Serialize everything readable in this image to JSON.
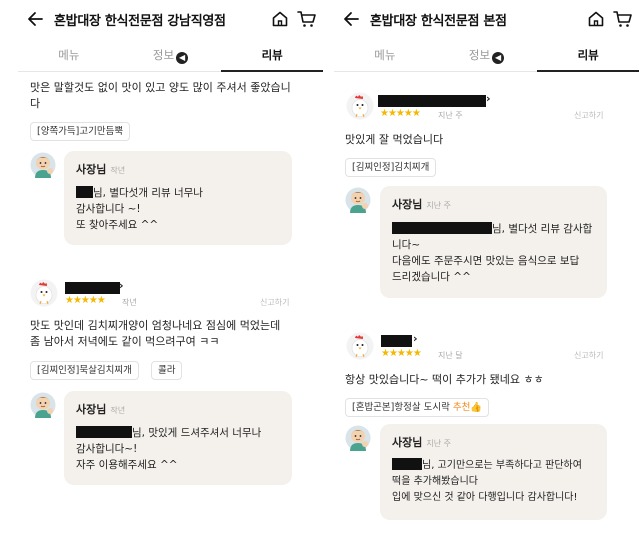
{
  "left": {
    "title": "혼밥대장 한식전문점 강남직영점",
    "tabs": [
      "메뉴",
      "정보",
      "리뷰"
    ],
    "review1_text": "맛은 말할것도 없이 맛이 있고 양도 많이 주셔서 좋았습니",
    "review1_text2": "다",
    "review1_tag": "[양쪽가득]고기만듬뿍",
    "reply1_name": "사장님",
    "reply1_name_small": "작년",
    "reply1_line1_suffix": "님, 별다섯개 리뷰 너무나",
    "reply1_line2": "감사합니다 ~!",
    "reply1_line3": "또 찾아주세요 ^^",
    "review2_stars": "★★★★★",
    "review2_date": "작년",
    "review2_report": "신고하기",
    "review2_text1": "맛도 맛인데 김치찌개양이 엄청나네요 점심에 먹었는데",
    "review2_text2": "좀 남아서 저녁에도 같이 먹으려구여 ㅋㅋ",
    "review2_tag1": "[김찌인정]묵살김치찌개",
    "review2_tag2": "콜라",
    "reply2_name": "사장님",
    "reply2_name_small": "작년",
    "reply2_line1_suffix": "님, 맛있게 드셔주셔서 너무나",
    "reply2_line2": "감사합니다~!",
    "reply2_line3": "자주 이용해주세요 ^^"
  },
  "right": {
    "title": "혼밥대장 한식전문점 본점",
    "tabs": [
      "메뉴",
      "정보",
      "리뷰"
    ],
    "review1_stars": "★★★★★",
    "review1_date": "지난 주",
    "review1_report": "신고하기",
    "review1_text": "맛있게 잘 먹었습니다",
    "review1_tag": "[김찌인정]김치찌개",
    "reply1_name": "사장님",
    "reply1_name_small": "지난 주",
    "reply1_line1_suffix": "님, 별다섯 리뷰 감사합",
    "reply1_line2": "니다~",
    "reply1_line3": "다음에도 주문주시면 맛있는 음식으로 보답",
    "reply1_line4": "드리겠습니다 ^^",
    "review2_stars": "★★★★★",
    "review2_date": "지난 달",
    "review2_report": "신고하기",
    "review2_text": "항상 맛있습니다~ 떡이 추가가 됐네요 ㅎㅎ",
    "review2_tag": "[혼밥곤본]항정살 도시락",
    "review2_tag_rec": "추천👍",
    "reply2_name": "사장님",
    "reply2_name_small": "지난 주",
    "reply2_line1_suffix": "님, 고기만으로는 부족하다고 판단하여",
    "reply2_line2": "떡을 추가해봤습니다",
    "reply2_line3": "입에 맞으신 것 같아 다행입니다 감사합니다!"
  },
  "colors": {
    "reply_bg": "#f4f1ec",
    "star": "#f5b800",
    "accent": "#f28a1c"
  },
  "icons": [
    "back-arrow-icon",
    "home-icon",
    "cart-icon",
    "info-icon",
    "owner-avatar-icon",
    "chicken-avatar-icon",
    "chevron-right-icon"
  ]
}
